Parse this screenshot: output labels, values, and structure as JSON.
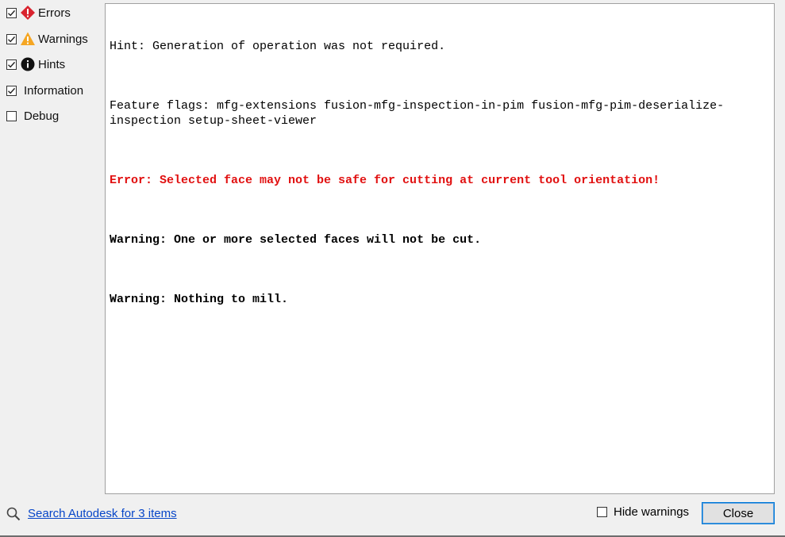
{
  "filters": [
    {
      "label": "Errors",
      "checked": true,
      "icon": "error-diamond-icon"
    },
    {
      "label": "Warnings",
      "checked": true,
      "icon": "warning-triangle-icon"
    },
    {
      "label": "Hints",
      "checked": true,
      "icon": "info-circle-icon"
    },
    {
      "label": "Information",
      "checked": true,
      "icon": ""
    },
    {
      "label": "Debug",
      "checked": false,
      "icon": ""
    }
  ],
  "log": {
    "lines": [
      {
        "type": "hint",
        "text": "Hint: Generation of operation was not required."
      },
      {
        "type": "hint",
        "text": "Feature flags: mfg-extensions fusion-mfg-inspection-in-pim fusion-mfg-pim-deserialize-inspection setup-sheet-viewer"
      },
      {
        "type": "error",
        "text": "Error: Selected face may not be safe for cutting at current tool orientation!"
      },
      {
        "type": "warning",
        "text": "Warning: One or more selected faces will not be cut."
      },
      {
        "type": "warning",
        "text": "Warning: Nothing to mill."
      }
    ]
  },
  "footer": {
    "search_link": "Search Autodesk for 3 items",
    "hide_warnings_label": "Hide warnings",
    "hide_warnings_checked": false,
    "close_label": "Close"
  },
  "colors": {
    "error": "#e11010",
    "link": "#0645c8",
    "error_icon": "#d9232e",
    "warning_icon": "#f5a623",
    "button_border": "#0078d7"
  }
}
